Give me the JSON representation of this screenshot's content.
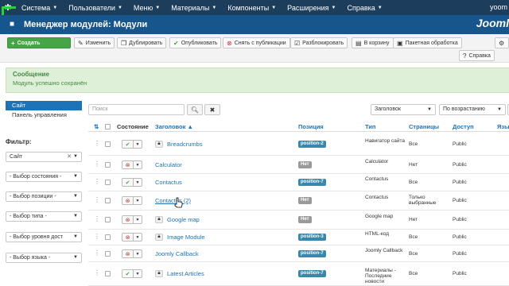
{
  "nav": {
    "menu": [
      "Система",
      "Пользователи",
      "Меню",
      "Материалы",
      "Компоненты",
      "Расширения",
      "Справка"
    ],
    "user": "yoom"
  },
  "header": {
    "title": "Менеджер модулей: Модули",
    "brand": "Jooml"
  },
  "toolbar": {
    "create": "Создать",
    "edit": "Изменить",
    "duplicate": "Дублировать",
    "publish": "Опубликовать",
    "unpublish": "Снять с публикации",
    "unlock": "Разблокировать",
    "trash": "В корзину",
    "batch": "Пакетная обработка",
    "help": "Справка"
  },
  "message": {
    "title": "Сообщение",
    "text": "Модуль успешно сохранён"
  },
  "sidebar": {
    "links": [
      "Сайт",
      "Панель управления"
    ],
    "filter_label": "Фильтр:",
    "filters": [
      "Сайт",
      "- Выбор состояния -",
      "- Выбор позиции -",
      "- Выбор типа -",
      "- Выбор уровня дост",
      "- Выбор языка -"
    ]
  },
  "search": {
    "placeholder": "Поиск"
  },
  "sort": {
    "field": "Заголовок",
    "order": "По возрастанию"
  },
  "table": {
    "headers": {
      "status": "Состояние",
      "title": "Заголовок",
      "position": "Позиция",
      "type": "Тип",
      "pages": "Страницы",
      "access": "Доступ",
      "lang": "Язы"
    },
    "rows": [
      {
        "published": true,
        "locked": true,
        "title": "Breadcrumbs",
        "position": "position-2",
        "pos_style": "blue",
        "type": "Навигатор сайта",
        "pages": "Все",
        "access": "Public"
      },
      {
        "published": false,
        "locked": false,
        "title": "Calculator",
        "position": "Нет",
        "pos_style": "gray",
        "type": "Calculator",
        "pages": "Нет",
        "access": "Public"
      },
      {
        "published": true,
        "locked": false,
        "title": "Contactus",
        "position": "position-7",
        "pos_style": "blue",
        "type": "Contactus",
        "pages": "Все",
        "access": "Public"
      },
      {
        "published": false,
        "locked": false,
        "title": "Contactus (2)",
        "position": "Нет",
        "pos_style": "gray",
        "type": "Contactus",
        "pages": "Только выбранные",
        "access": "Public"
      },
      {
        "published": false,
        "locked": true,
        "title": "Google map",
        "position": "Нет",
        "pos_style": "gray",
        "type": "Google map",
        "pages": "Нет",
        "access": "Public"
      },
      {
        "published": false,
        "locked": true,
        "title": "Image Module",
        "position": "position-3",
        "pos_style": "blue",
        "type": "HTML-код",
        "pages": "Все",
        "access": "Public"
      },
      {
        "published": false,
        "locked": false,
        "title": "Joomly Callback",
        "position": "position-7",
        "pos_style": "blue",
        "type": "Joomly Callback",
        "pages": "Все",
        "access": "Public"
      },
      {
        "published": true,
        "locked": true,
        "title": "Latest Articles",
        "position": "position-7",
        "pos_style": "blue",
        "type": "Материалы - Последние новости",
        "pages": "Все",
        "access": "Public"
      }
    ]
  }
}
